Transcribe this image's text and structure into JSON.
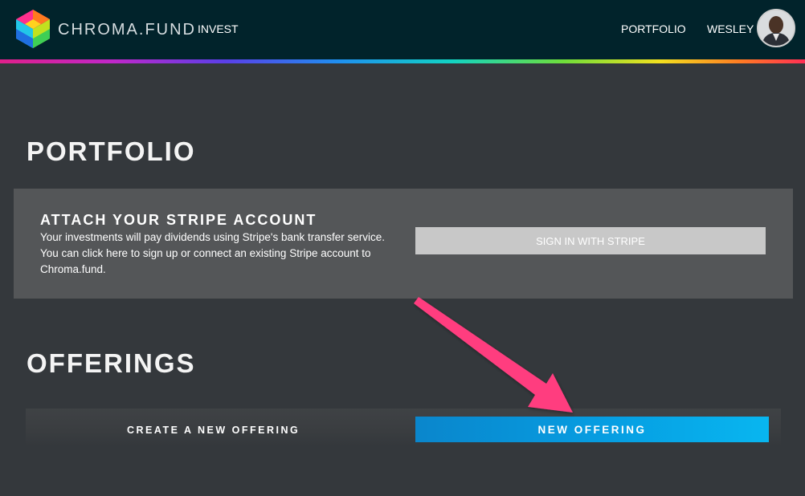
{
  "header": {
    "brand": "CHROMA.FUND",
    "nav": {
      "invest": "INVEST",
      "portfolio": "PORTFOLIO",
      "user": "WESLEY"
    },
    "icons": {
      "logo": "cube-logo-icon",
      "avatar": "user-avatar-photo"
    }
  },
  "portfolio": {
    "title": "PORTFOLIO",
    "stripe": {
      "heading": "ATTACH YOUR STRIPE ACCOUNT",
      "description": "Your investments will pay dividends using Stripe's bank transfer service. You can click here to sign up or connect an existing Stripe account to Chroma.fund.",
      "button_label": "SIGN IN WITH STRIPE"
    }
  },
  "offerings": {
    "title": "OFFERINGS",
    "create_label": "CREATE A NEW OFFERING",
    "button_label": "NEW OFFERING"
  },
  "annotation": {
    "icon": "pink-arrow-pointer",
    "color": "#ff3d7f"
  },
  "colors": {
    "background": "#34383c",
    "navbar": "#01232b",
    "card": "#545658",
    "stripe_button": "#c8c8c8",
    "accent_blue": "#069ee2"
  }
}
